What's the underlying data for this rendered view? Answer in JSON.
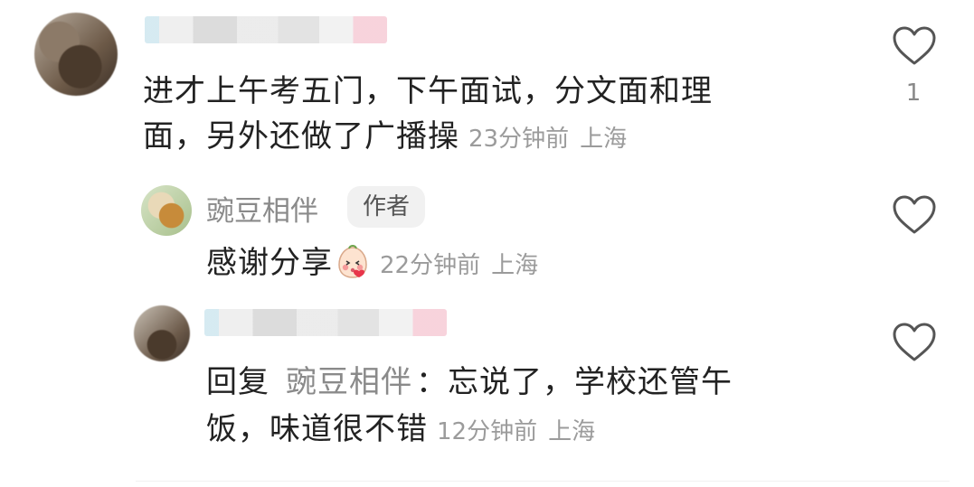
{
  "comments": [
    {
      "username": "",
      "line1": "进才上午考五门，下午面试，分文面和理",
      "line2": "面，另外还做了广播操",
      "time": "23分钟前",
      "location": "上海",
      "likes": "1"
    },
    {
      "username": "豌豆相伴",
      "badge": "作者",
      "text": "感谢分享",
      "emoji": "blush-kiss-emoji",
      "time": "22分钟前",
      "location": "上海"
    },
    {
      "username": "",
      "reply_prefix": "回复",
      "reply_target": "豌豆相伴",
      "line1_rest": "：忘说了，学校还管午",
      "line2": "饭，味道很不错",
      "time": "12分钟前",
      "location": "上海"
    }
  ],
  "icons": {
    "like": "heart-outline-icon"
  },
  "colors": {
    "text": "#222222",
    "meta": "#9b9b9b",
    "username": "#8a8a8a",
    "badge_bg": "#f1f1f1"
  }
}
